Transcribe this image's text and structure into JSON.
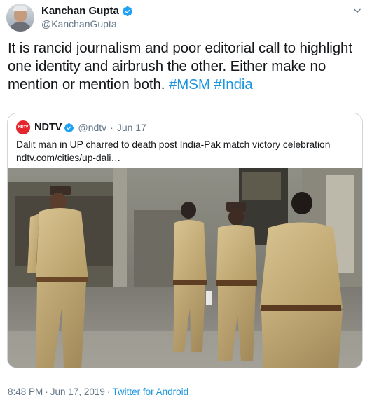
{
  "author": {
    "display_name": "Kanchan Gupta",
    "handle": "@KanchanGupta"
  },
  "tweet": {
    "text_before": "It is rancid journalism and poor editorial call to highlight one identity and airbrush the other. Either make no mention or mention both. ",
    "hashtag_1": "#MSM",
    "hashtag_2": "#India"
  },
  "quote": {
    "logo_text": "NDTV",
    "display_name": "NDTV",
    "handle": "@ndtv",
    "separator": "·",
    "date": "Jun 17",
    "text": "Dalit man in UP charred to death post India-Pak match victory celebration",
    "link": "ndtv.com/cities/up-dali…"
  },
  "footer": {
    "time": "8:48 PM",
    "date": "Jun 17, 2019",
    "separator": "·",
    "source": "Twitter for Android"
  },
  "icons": {
    "verified": "verified-badge-icon",
    "chevron": "chevron-down-icon"
  },
  "colors": {
    "link": "#1b95e0",
    "verified": "#1da1f2",
    "ndtv_red": "#e5242b",
    "muted_text": "#657786"
  }
}
